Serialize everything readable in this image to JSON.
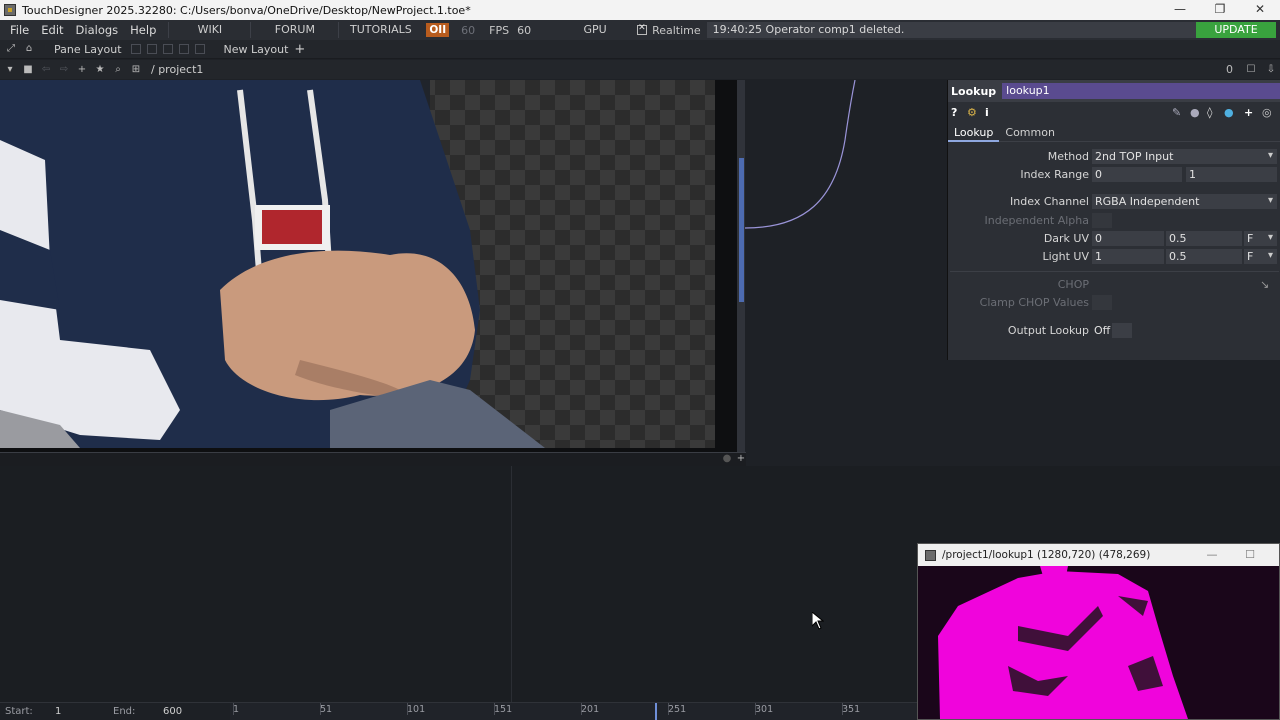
{
  "window": {
    "title": "TouchDesigner 2025.32280: C:/Users/bonva/OneDrive/Desktop/NewProject.1.toe*",
    "controls": [
      "—",
      "❐",
      "✕"
    ]
  },
  "menubar": {
    "items": [
      "File",
      "Edit",
      "Dialogs",
      "Help"
    ],
    "toolbar": {
      "wiki": "WIKI",
      "forum": "FORUM",
      "tutorials": "TUTORIALS",
      "oii": "OII",
      "fps_value_dim": "60",
      "fps_label": "FPS",
      "fps_value": "60",
      "gpu": "GPU",
      "realtime": "Realtime",
      "status": "19:40:25 Operator comp1 deleted.",
      "update": "UPDATE"
    }
  },
  "panebar": {
    "pane_layout": "Pane Layout",
    "new_layout": "New Layout",
    "plus": "+"
  },
  "pathbar": {
    "path": "/ project1",
    "count": "0"
  },
  "params": {
    "op_type": "Lookup",
    "op_name": "lookup1",
    "tabs": [
      "Lookup",
      "Common"
    ],
    "method_label": "Method",
    "method_value": "2nd TOP Input",
    "index_range_label": "Index Range",
    "index_range": [
      "0",
      "1"
    ],
    "index_channel_label": "Index Channel",
    "index_channel_value": "RGBA Independent",
    "independent_alpha_label": "Independent Alpha",
    "dark_uv_label": "Dark UV",
    "dark_uv": [
      "0",
      "0.5"
    ],
    "light_uv_label": "Light UV",
    "light_uv": [
      "1",
      "0.5"
    ],
    "uv_mode": "F",
    "chop_label": "CHOP",
    "clamp_chop_label": "Clamp CHOP Values",
    "output_lookup_label": "Output Lookup",
    "output_lookup_value": "Off"
  },
  "floating_viewer": {
    "title": "/project1/lookup1 (1280,720) (478,269)",
    "controls": [
      "—",
      "☐"
    ]
  },
  "timeline": {
    "start_label": "Start:",
    "start_value": "1",
    "end_label": "End:",
    "end_value": "600",
    "ticks": [
      "1",
      "51",
      "101",
      "151",
      "201",
      "251",
      "301",
      "351"
    ]
  },
  "colors": {
    "accent_purple": "#5a4b8f",
    "update_green": "#39a33e",
    "oii_orange": "#b85c1e",
    "magenta": "#ff00ff"
  }
}
